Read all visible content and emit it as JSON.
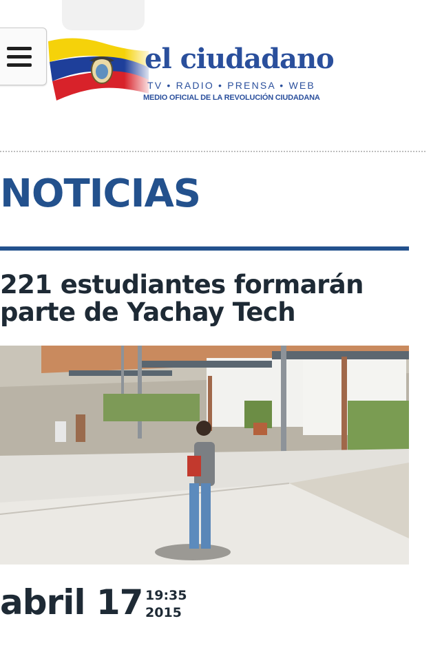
{
  "header": {
    "menu_icon": "hamburger-menu-icon",
    "brand": {
      "name": "el ciudadano",
      "subtitle": "TV • RADIO • PRENSA • WEB",
      "tagline": "MEDIO OFICIAL DE LA REVOLUCIÓN CIUDADANA",
      "colors": {
        "brand_blue": "#2a4f9c",
        "flag_yellow": "#f5d20a",
        "flag_blue": "#1e3f9a",
        "flag_red": "#d8222a"
      }
    }
  },
  "section": {
    "title": "NOTICIAS",
    "accent_color": "#23518d"
  },
  "article": {
    "headline": "221 estudiantes  formarán parte de Yachay Tech",
    "date": {
      "day": "abril 17",
      "time": "19:35",
      "year": "2015"
    }
  }
}
